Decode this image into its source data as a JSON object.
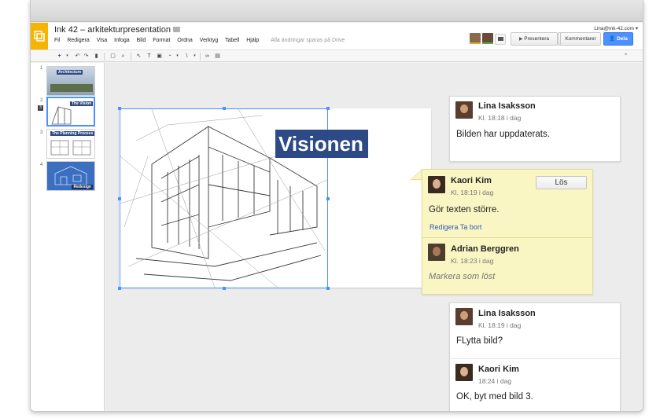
{
  "app": {
    "doc_title": "Ink 42 – arkitekturpresentation",
    "menu": [
      "Fil",
      "Redigera",
      "Visa",
      "Infoga",
      "Bild",
      "Format",
      "Ordna",
      "Verktyg",
      "Tabell",
      "Hjälp"
    ],
    "saved_status": "Alla ändringar sparas på Drive",
    "user_email": "Lina@ink-42.com ▾",
    "present_label": "Presentera",
    "comments_label": "Kommentarer",
    "share_label": "Dela",
    "accent_color": "#4d90fe",
    "logo_color": "#f4b400"
  },
  "slides": [
    {
      "number": "1",
      "title": "Architecture"
    },
    {
      "number": "2",
      "title": "The Vision"
    },
    {
      "number": "3",
      "title": "The Planning Process"
    },
    {
      "number": "4",
      "title": "Redesign"
    }
  ],
  "current_slide_badge": "3",
  "slide": {
    "heading": "Visionen"
  },
  "comments": [
    {
      "author": "Lina Isaksson",
      "time": "Kl. 18:18 i dag",
      "text": "Bilden har uppdaterats."
    },
    {
      "author": "Kaori Kim",
      "time": "Kl. 18:19 i dag",
      "text": "Gör texten större.",
      "resolve_label": "Lös",
      "edit_label": "Redigera",
      "delete_label": "Ta bort",
      "reply": {
        "author": "Adrian Berggren",
        "time": "Kl. 18:23 i dag",
        "placeholder": "Markera som löst"
      }
    },
    {
      "author": "Lina Isaksson",
      "time": "Kl. 18:19 i dag",
      "text": "FLytta bild?",
      "reply": {
        "author": "Kaori Kim",
        "time": "18:24 i dag",
        "text": "OK, byt med bild 3."
      }
    }
  ]
}
